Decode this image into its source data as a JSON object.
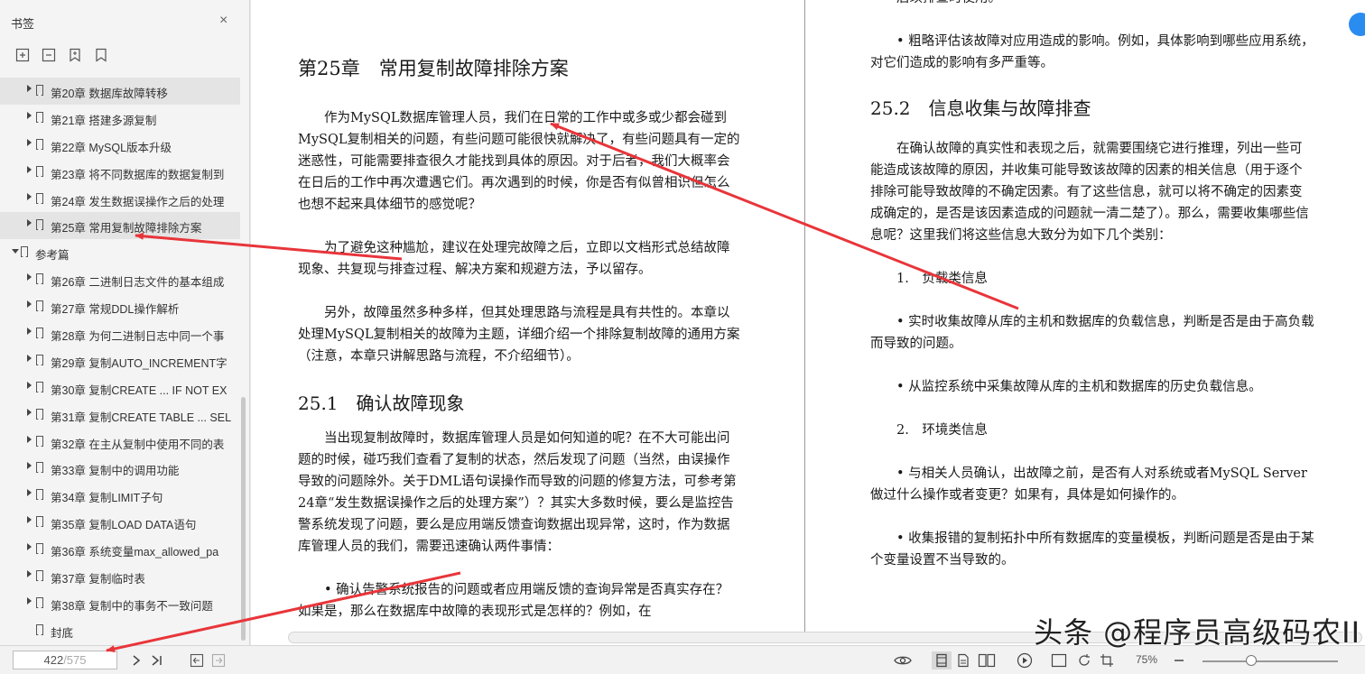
{
  "sidebar": {
    "title": "书签",
    "close": "×",
    "tools": [
      "expand-all-icon",
      "collapse-all-icon",
      "add-bookmark-icon",
      "bookmark-icon"
    ],
    "items": [
      {
        "label": "第20章 数据库故障转移",
        "indent": 1,
        "arrow": "right",
        "selected": true
      },
      {
        "label": "第21章 搭建多源复制",
        "indent": 1,
        "arrow": "right"
      },
      {
        "label": "第22章 MySQL版本升级",
        "indent": 1,
        "arrow": "right"
      },
      {
        "label": "第23章 将不同数据库的数据复制到",
        "indent": 1,
        "arrow": "right"
      },
      {
        "label": "第24章 发生数据误操作之后的处理",
        "indent": 1,
        "arrow": "right"
      },
      {
        "label": "第25章 常用复制故障排除方案",
        "indent": 1,
        "arrow": "right",
        "selected": true
      },
      {
        "label": "参考篇",
        "indent": 0,
        "arrow": "down"
      },
      {
        "label": "第26章 二进制日志文件的基本组成",
        "indent": 1,
        "arrow": "right"
      },
      {
        "label": "第27章 常规DDL操作解析",
        "indent": 1,
        "arrow": "right"
      },
      {
        "label": "第28章 为何二进制日志中同一个事",
        "indent": 1,
        "arrow": "right"
      },
      {
        "label": "第29章 复制AUTO_INCREMENT字",
        "indent": 1,
        "arrow": "right"
      },
      {
        "label": "第30章 复制CREATE ... IF NOT EX",
        "indent": 1,
        "arrow": "right"
      },
      {
        "label": "第31章 复制CREATE TABLE ... SEL",
        "indent": 1,
        "arrow": "right"
      },
      {
        "label": "第32章 在主从复制中使用不同的表",
        "indent": 1,
        "arrow": "right"
      },
      {
        "label": "第33章 复制中的调用功能",
        "indent": 1,
        "arrow": "right"
      },
      {
        "label": "第34章 复制LIMIT子句",
        "indent": 1,
        "arrow": "right"
      },
      {
        "label": "第35章 复制LOAD DATA语句",
        "indent": 1,
        "arrow": "right"
      },
      {
        "label": "第36章 系统变量max_allowed_pa",
        "indent": 1,
        "arrow": "right"
      },
      {
        "label": "第37章 复制临时表",
        "indent": 1,
        "arrow": "right"
      },
      {
        "label": "第38章 复制中的事务不一致问题",
        "indent": 1,
        "arrow": "right"
      },
      {
        "label": "封底",
        "indent": 1,
        "arrow": "none"
      }
    ]
  },
  "left_page": {
    "chapter_title": "第25章　常用复制故障排除方案",
    "intro_paras": [
      "作为MySQL数据库管理人员，我们在日常的工作中或多或少都会碰到MySQL复制相关的问题，有些问题可能很快就解决了，有些问题具有一定的迷惑性，可能需要排查很久才能找到具体的原因。对于后者，我们大概率会在日后的工作中再次遭遇它们。再次遇到的时候，你是否有似曾相识但怎么也想不起来具体细节的感觉呢？",
      "为了避免这种尴尬，建议在处理完故障之后，立即以文档形式总结故障现象、共复现与排查过程、解决方案和规避方法，予以留存。",
      "另外，故障虽然多种多样，但其处理思路与流程是具有共性的。本章以处理MySQL复制相关的故障为主题，详细介绍一个排除复制故障的通用方案（注意，本章只讲解思路与流程，不介绍细节）。"
    ],
    "section_title": "25.1　确认故障现象",
    "section_paras": [
      "当出现复制故障时，数据库管理人员是如何知道的呢？在不大可能出问题的时候，碰巧我们查看了复制的状态，然后发现了问题（当然，由误操作导致的问题除外。关于DML语句误操作而导致的问题的修复方法，可参考第24章“发生数据误操作之后的处理方案”）？其实大多数时候，要么是监控告警系统发现了问题，要么是应用端反馈查询数据出现异常，这时，作为数据库管理人员的我们，需要迅速确认两件事情：",
      "• 确认告警系统报告的问题或者应用端反馈的查询异常是否真实存在？如果是，那么在数据库中故障的表现形式是怎样的？例如，在"
    ]
  },
  "right_page": {
    "top_cut": "后续排查时使用。",
    "para1": "• 粗略评估该故障对应用造成的影响。例如，具体影响到哪些应用系统，对它们造成的影响有多严重等。",
    "section_title": "25.2　信息收集与故障排查",
    "para2": "在确认故障的真实性和表现之后，就需要围绕它进行推理，列出一些可能造成该故障的原因，并收集可能导致该故障的因素的相关信息（用于逐个排除可能导致故障的不确定因素。有了这些信息，就可以将不确定的因素变成确定的，是否是该因素造成的问题就一清二楚了）。那么，需要收集哪些信息呢？这里我们将这些信息大致分为如下几个类别：",
    "item1": "1.　负载类信息",
    "para3": "• 实时收集故障从库的主机和数据库的负载信息，判断是否是由于高负载而导致的问题。",
    "para4": "• 从监控系统中采集故障从库的主机和数据库的历史负载信息。",
    "item2": "2.　环境类信息",
    "para5": "• 与相关人员确认，出故障之前，是否有人对系统或者MySQL Server做过什么操作或者变更？如果有，具体是如何操作的。",
    "para6": "• 收集报错的复制拓扑中所有数据库的变量模板，判断问题是否是由于某个变量设置不当导致的。"
  },
  "bottombar": {
    "page_current": "422",
    "page_total": "/575",
    "zoom": "75%"
  },
  "watermark": "头条 @程序员高级码农II",
  "colors": {
    "arrow": "#e8353a",
    "badge": "#2b8cf0"
  }
}
